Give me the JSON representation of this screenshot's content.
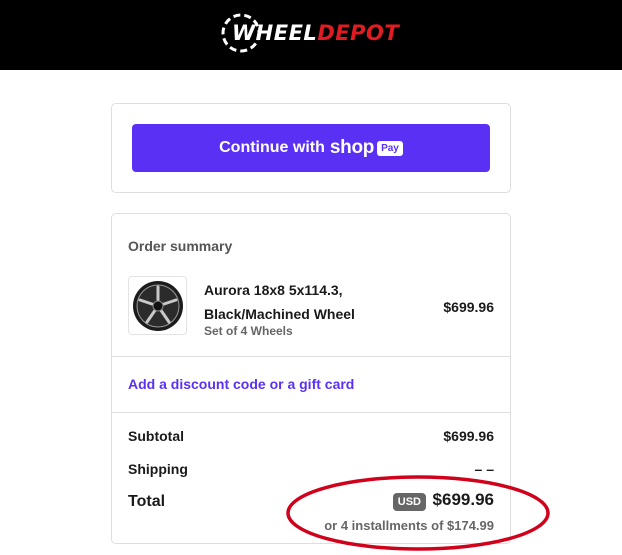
{
  "brand": {
    "logo_part1": "WHEEL",
    "logo_part2": "DEPOT",
    "logo_icon": "tire-ring-icon",
    "primary_color": "#e11b22"
  },
  "express_checkout": {
    "label": "Continue with",
    "shop_word": "shop",
    "pay_word": "Pay",
    "button_color": "#5a31f4"
  },
  "summary": {
    "title": "Order summary",
    "item": {
      "name": "Aurora 18x8 5x114.3, Black/Machined Wheel",
      "variant": "Set of 4 Wheels",
      "price": "$699.96",
      "thumbnail_icon": "wheel-image-icon"
    },
    "discount_link": "Add a discount code or a gift card",
    "subtotal_label": "Subtotal",
    "subtotal_value": "$699.96",
    "shipping_label": "Shipping",
    "shipping_value": "– –",
    "total_label": "Total",
    "currency": "USD",
    "total_value": "$699.96",
    "installments": "or 4 installments of $174.99"
  },
  "annotation": {
    "shape": "ellipse",
    "color": "#d0021b"
  }
}
